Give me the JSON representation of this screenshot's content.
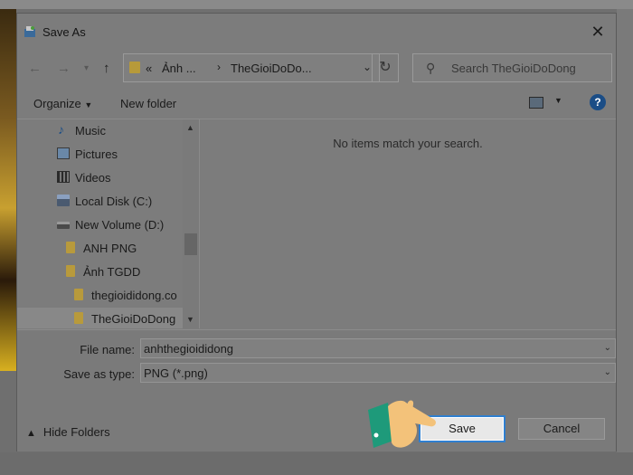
{
  "window": {
    "title": "Save As"
  },
  "navigation": {
    "address": {
      "overflow": "«",
      "crumbs": [
        "Ảnh ...",
        "TheGioiDoDo..."
      ]
    },
    "search_placeholder": "Search TheGioiDoDong"
  },
  "toolbar": {
    "organize_label": "Organize",
    "new_folder_label": "New folder",
    "help_label": "?"
  },
  "sidebar": {
    "items": [
      {
        "label": "Music",
        "icon": "music-icon"
      },
      {
        "label": "Pictures",
        "icon": "pictures-icon"
      },
      {
        "label": "Videos",
        "icon": "videos-icon"
      },
      {
        "label": "Local Disk (C:)",
        "icon": "local-disk-icon"
      },
      {
        "label": "New Volume (D:)",
        "icon": "drive-icon"
      },
      {
        "label": "ANH PNG",
        "icon": "folder-icon"
      },
      {
        "label": "Ảnh TGDD",
        "icon": "folder-icon"
      },
      {
        "label": "thegioididong.co",
        "icon": "folder-icon"
      },
      {
        "label": "TheGioiDoDong",
        "icon": "folder-icon",
        "selected": true
      }
    ]
  },
  "content": {
    "empty_message": "No items match your search."
  },
  "form": {
    "file_name_label": "File name:",
    "file_name_value": "anhthegioididong",
    "save_type_label": "Save as type:",
    "save_type_value": "PNG (*.png)"
  },
  "footer": {
    "hide_folders_label": "Hide Folders",
    "save_label": "Save",
    "cancel_label": "Cancel"
  },
  "colors": {
    "accent": "#2f7fd0",
    "help_blue": "#1b4d86",
    "folder": "#b89a3c"
  }
}
